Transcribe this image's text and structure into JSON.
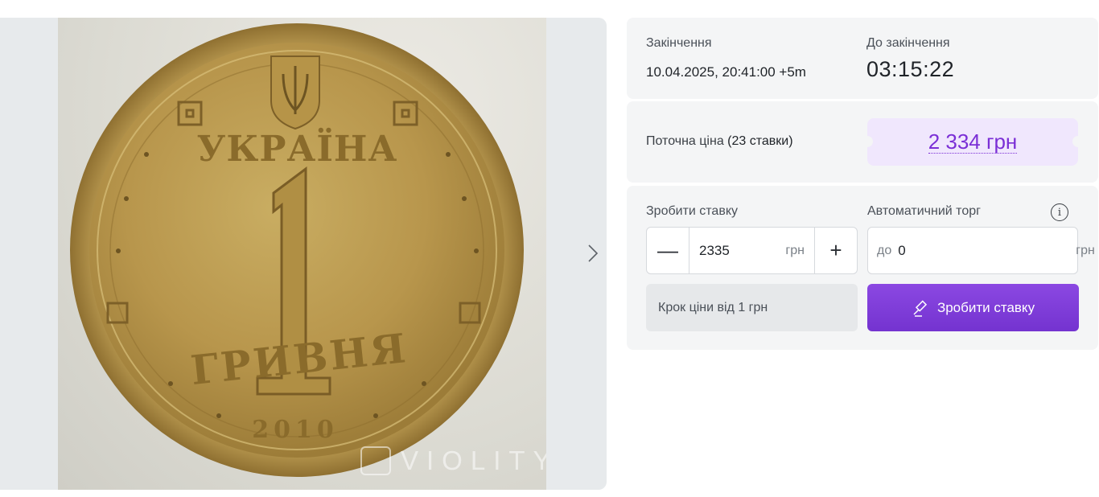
{
  "gallery": {
    "coin_top_text": "УКРАЇНА",
    "coin_denomination": "1",
    "coin_bottom_text": "ГРИВНЯ",
    "coin_year": "2010",
    "watermark": "VIOLITY",
    "next_icon": "chevron-right-icon"
  },
  "end_info": {
    "end_label": "Закінчення",
    "end_value": "10.04.2025, 20:41:00 +5m",
    "remaining_label": "До закінчення",
    "remaining_value": "03:15:22"
  },
  "price": {
    "label": "Поточна ціна",
    "bids_count": "(23 ставки)",
    "value": "2 334 грн",
    "accent_color": "#7b2fd6"
  },
  "bid": {
    "make_bid_label": "Зробити ставку",
    "bid_amount": "2335",
    "currency": "грн",
    "minus_symbol": "—",
    "plus_symbol": "+",
    "auto_label": "Автоматичний торг",
    "auto_prefix": "до",
    "auto_value": "0",
    "auto_currency": "грн",
    "info_icon": "i",
    "step_note": "Крок ціни від 1 грн",
    "submit_label": "Зробити ставку",
    "submit_icon": "gavel-icon",
    "button_color": "#7a36d4"
  }
}
